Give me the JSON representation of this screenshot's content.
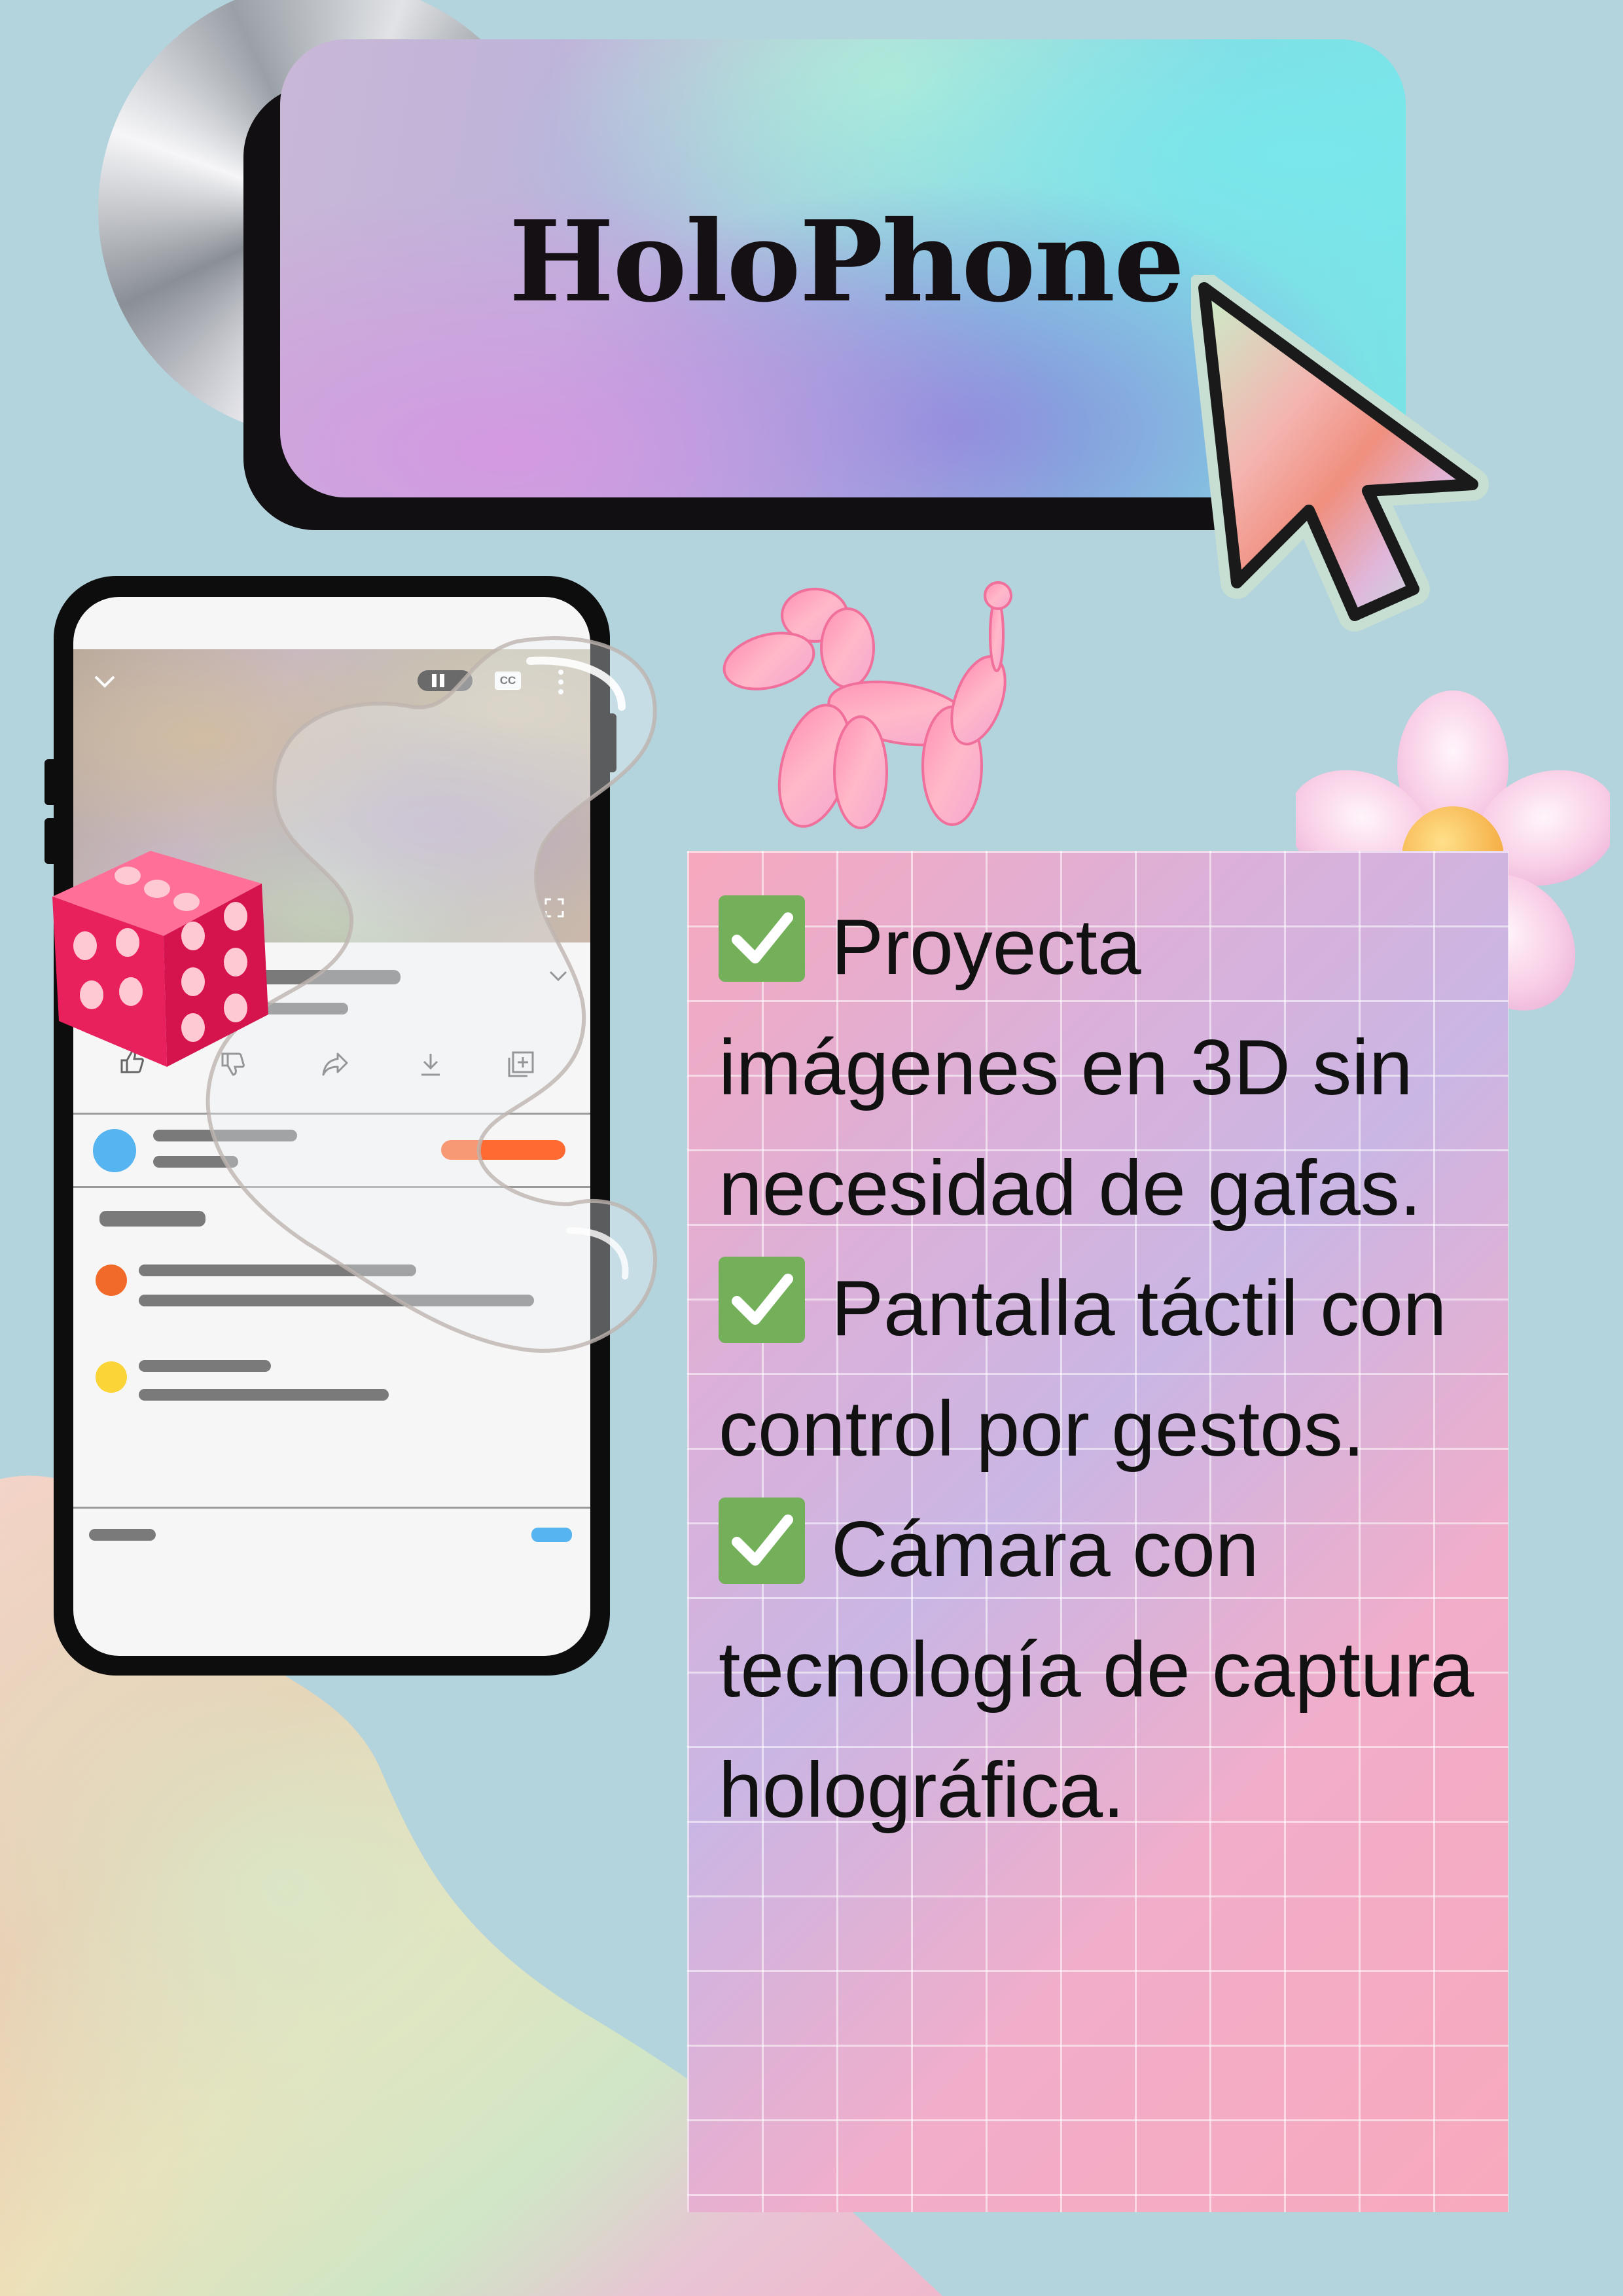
{
  "title": "HoloPhone",
  "features": [
    {
      "icon": "check-mark-icon",
      "text": "Proyecta imágenes en 3D sin necesidad de gafas."
    },
    {
      "icon": "check-mark-icon",
      "text": "Pantalla táctil con control por gestos."
    },
    {
      "icon": "check-mark-icon",
      "text": "Cámara con tecnología de captura holográfica."
    }
  ],
  "phone_screen": {
    "video_controls": [
      "chevron-down-icon",
      "pause-icon",
      "closed-captions-icon",
      "more-vertical-icon",
      "fullscreen-icon"
    ],
    "video_controls_cc_label": "CC",
    "action_icons": [
      "like-icon",
      "dislike-icon",
      "share-icon",
      "download-icon",
      "save-icon"
    ]
  },
  "colors": {
    "background": "#b3d3dd",
    "title_text": "#141014",
    "check_box": "#74b05a",
    "subscribe_button": "#ff6a33",
    "avatar": "#56b4f0",
    "comment_dot_orange": "#f26a2a",
    "comment_dot_yellow": "#fbd437",
    "toggle": "#56b4f0"
  }
}
